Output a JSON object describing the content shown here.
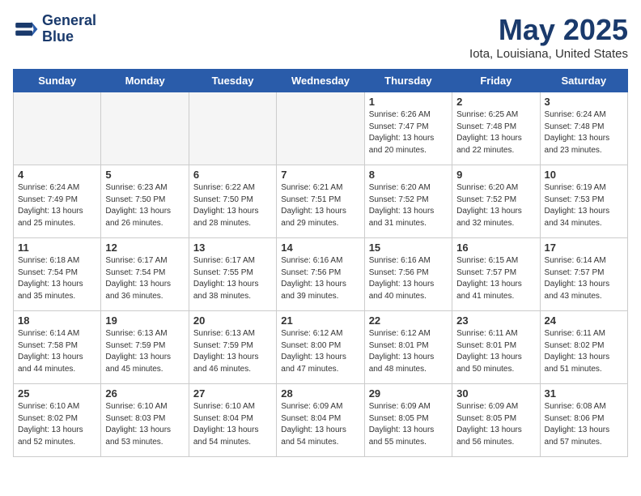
{
  "header": {
    "logo_line1": "General",
    "logo_line2": "Blue",
    "month_title": "May 2025",
    "location": "Iota, Louisiana, United States"
  },
  "weekdays": [
    "Sunday",
    "Monday",
    "Tuesday",
    "Wednesday",
    "Thursday",
    "Friday",
    "Saturday"
  ],
  "weeks": [
    [
      {
        "day": "",
        "info": ""
      },
      {
        "day": "",
        "info": ""
      },
      {
        "day": "",
        "info": ""
      },
      {
        "day": "",
        "info": ""
      },
      {
        "day": "1",
        "info": "Sunrise: 6:26 AM\nSunset: 7:47 PM\nDaylight: 13 hours\nand 20 minutes."
      },
      {
        "day": "2",
        "info": "Sunrise: 6:25 AM\nSunset: 7:48 PM\nDaylight: 13 hours\nand 22 minutes."
      },
      {
        "day": "3",
        "info": "Sunrise: 6:24 AM\nSunset: 7:48 PM\nDaylight: 13 hours\nand 23 minutes."
      }
    ],
    [
      {
        "day": "4",
        "info": "Sunrise: 6:24 AM\nSunset: 7:49 PM\nDaylight: 13 hours\nand 25 minutes."
      },
      {
        "day": "5",
        "info": "Sunrise: 6:23 AM\nSunset: 7:50 PM\nDaylight: 13 hours\nand 26 minutes."
      },
      {
        "day": "6",
        "info": "Sunrise: 6:22 AM\nSunset: 7:50 PM\nDaylight: 13 hours\nand 28 minutes."
      },
      {
        "day": "7",
        "info": "Sunrise: 6:21 AM\nSunset: 7:51 PM\nDaylight: 13 hours\nand 29 minutes."
      },
      {
        "day": "8",
        "info": "Sunrise: 6:20 AM\nSunset: 7:52 PM\nDaylight: 13 hours\nand 31 minutes."
      },
      {
        "day": "9",
        "info": "Sunrise: 6:20 AM\nSunset: 7:52 PM\nDaylight: 13 hours\nand 32 minutes."
      },
      {
        "day": "10",
        "info": "Sunrise: 6:19 AM\nSunset: 7:53 PM\nDaylight: 13 hours\nand 34 minutes."
      }
    ],
    [
      {
        "day": "11",
        "info": "Sunrise: 6:18 AM\nSunset: 7:54 PM\nDaylight: 13 hours\nand 35 minutes."
      },
      {
        "day": "12",
        "info": "Sunrise: 6:17 AM\nSunset: 7:54 PM\nDaylight: 13 hours\nand 36 minutes."
      },
      {
        "day": "13",
        "info": "Sunrise: 6:17 AM\nSunset: 7:55 PM\nDaylight: 13 hours\nand 38 minutes."
      },
      {
        "day": "14",
        "info": "Sunrise: 6:16 AM\nSunset: 7:56 PM\nDaylight: 13 hours\nand 39 minutes."
      },
      {
        "day": "15",
        "info": "Sunrise: 6:16 AM\nSunset: 7:56 PM\nDaylight: 13 hours\nand 40 minutes."
      },
      {
        "day": "16",
        "info": "Sunrise: 6:15 AM\nSunset: 7:57 PM\nDaylight: 13 hours\nand 41 minutes."
      },
      {
        "day": "17",
        "info": "Sunrise: 6:14 AM\nSunset: 7:57 PM\nDaylight: 13 hours\nand 43 minutes."
      }
    ],
    [
      {
        "day": "18",
        "info": "Sunrise: 6:14 AM\nSunset: 7:58 PM\nDaylight: 13 hours\nand 44 minutes."
      },
      {
        "day": "19",
        "info": "Sunrise: 6:13 AM\nSunset: 7:59 PM\nDaylight: 13 hours\nand 45 minutes."
      },
      {
        "day": "20",
        "info": "Sunrise: 6:13 AM\nSunset: 7:59 PM\nDaylight: 13 hours\nand 46 minutes."
      },
      {
        "day": "21",
        "info": "Sunrise: 6:12 AM\nSunset: 8:00 PM\nDaylight: 13 hours\nand 47 minutes."
      },
      {
        "day": "22",
        "info": "Sunrise: 6:12 AM\nSunset: 8:01 PM\nDaylight: 13 hours\nand 48 minutes."
      },
      {
        "day": "23",
        "info": "Sunrise: 6:11 AM\nSunset: 8:01 PM\nDaylight: 13 hours\nand 50 minutes."
      },
      {
        "day": "24",
        "info": "Sunrise: 6:11 AM\nSunset: 8:02 PM\nDaylight: 13 hours\nand 51 minutes."
      }
    ],
    [
      {
        "day": "25",
        "info": "Sunrise: 6:10 AM\nSunset: 8:02 PM\nDaylight: 13 hours\nand 52 minutes."
      },
      {
        "day": "26",
        "info": "Sunrise: 6:10 AM\nSunset: 8:03 PM\nDaylight: 13 hours\nand 53 minutes."
      },
      {
        "day": "27",
        "info": "Sunrise: 6:10 AM\nSunset: 8:04 PM\nDaylight: 13 hours\nand 54 minutes."
      },
      {
        "day": "28",
        "info": "Sunrise: 6:09 AM\nSunset: 8:04 PM\nDaylight: 13 hours\nand 54 minutes."
      },
      {
        "day": "29",
        "info": "Sunrise: 6:09 AM\nSunset: 8:05 PM\nDaylight: 13 hours\nand 55 minutes."
      },
      {
        "day": "30",
        "info": "Sunrise: 6:09 AM\nSunset: 8:05 PM\nDaylight: 13 hours\nand 56 minutes."
      },
      {
        "day": "31",
        "info": "Sunrise: 6:08 AM\nSunset: 8:06 PM\nDaylight: 13 hours\nand 57 minutes."
      }
    ]
  ]
}
